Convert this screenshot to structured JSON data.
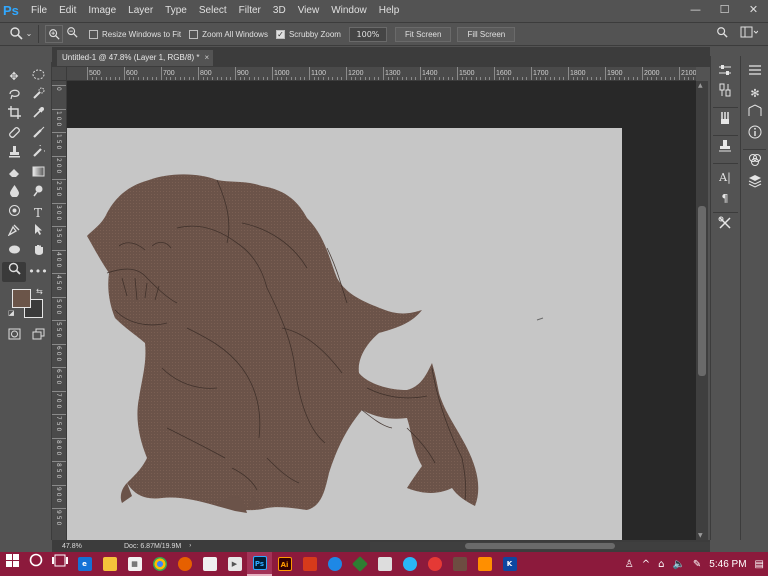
{
  "app": {
    "logo": "Ps",
    "menu": [
      "File",
      "Edit",
      "Image",
      "Layer",
      "Type",
      "Select",
      "Filter",
      "3D",
      "View",
      "Window",
      "Help"
    ],
    "window_controls": [
      "—",
      "☐",
      "✕"
    ]
  },
  "options_bar": {
    "resize_windows_label": "Resize Windows to Fit",
    "resize_windows_checked": false,
    "zoom_all_windows_label": "Zoom All Windows",
    "zoom_all_windows_checked": false,
    "scrubby_zoom_label": "Scrubby Zoom",
    "scrubby_zoom_checked": true,
    "zoom_value": "100%",
    "fit_screen_label": "Fit Screen",
    "fill_screen_label": "Fill Screen"
  },
  "document": {
    "tab_title": "Untitled-1 @ 47.8% (Layer 1, RGB/8) *",
    "close_glyph": "×"
  },
  "ruler": {
    "top_labels": [
      "500",
      "600",
      "700",
      "800",
      "900",
      "1000",
      "1100",
      "1200",
      "1300",
      "1400",
      "1500",
      "1600",
      "1700",
      "1800",
      "1900",
      "2000",
      "2100"
    ],
    "left_labels": [
      "0",
      "1 0 0",
      "1 5 0",
      "2 0 0",
      "2 5 0",
      "3 0 0",
      "3 5 0",
      "4 0 0",
      "4 5 0",
      "5 0 0",
      "5 5 0",
      "6 0 0",
      "6 5 0",
      "7 0 0",
      "7 5 0",
      "8 0 0",
      "8 5 0",
      "9 0 0",
      "9 5 0"
    ]
  },
  "colors": {
    "foreground": "#6b5549",
    "background": "#3a3a3a",
    "taskbar": "#8c1a3c",
    "canvas": "#c6c6c6"
  },
  "status_bar": {
    "zoom": "47.8%",
    "doc_info": "Doc: 6.87M/19.9M"
  },
  "taskbar": {
    "time": "5:46 PM",
    "apps": [
      "file-explorer",
      "edge",
      "folder",
      "store",
      "chrome",
      "firefox",
      "notes",
      "media",
      "photoshop",
      "illustrator",
      "app-1",
      "vpn",
      "app-2",
      "browser",
      "app-3",
      "app-4",
      "app-5",
      "app-6"
    ]
  }
}
